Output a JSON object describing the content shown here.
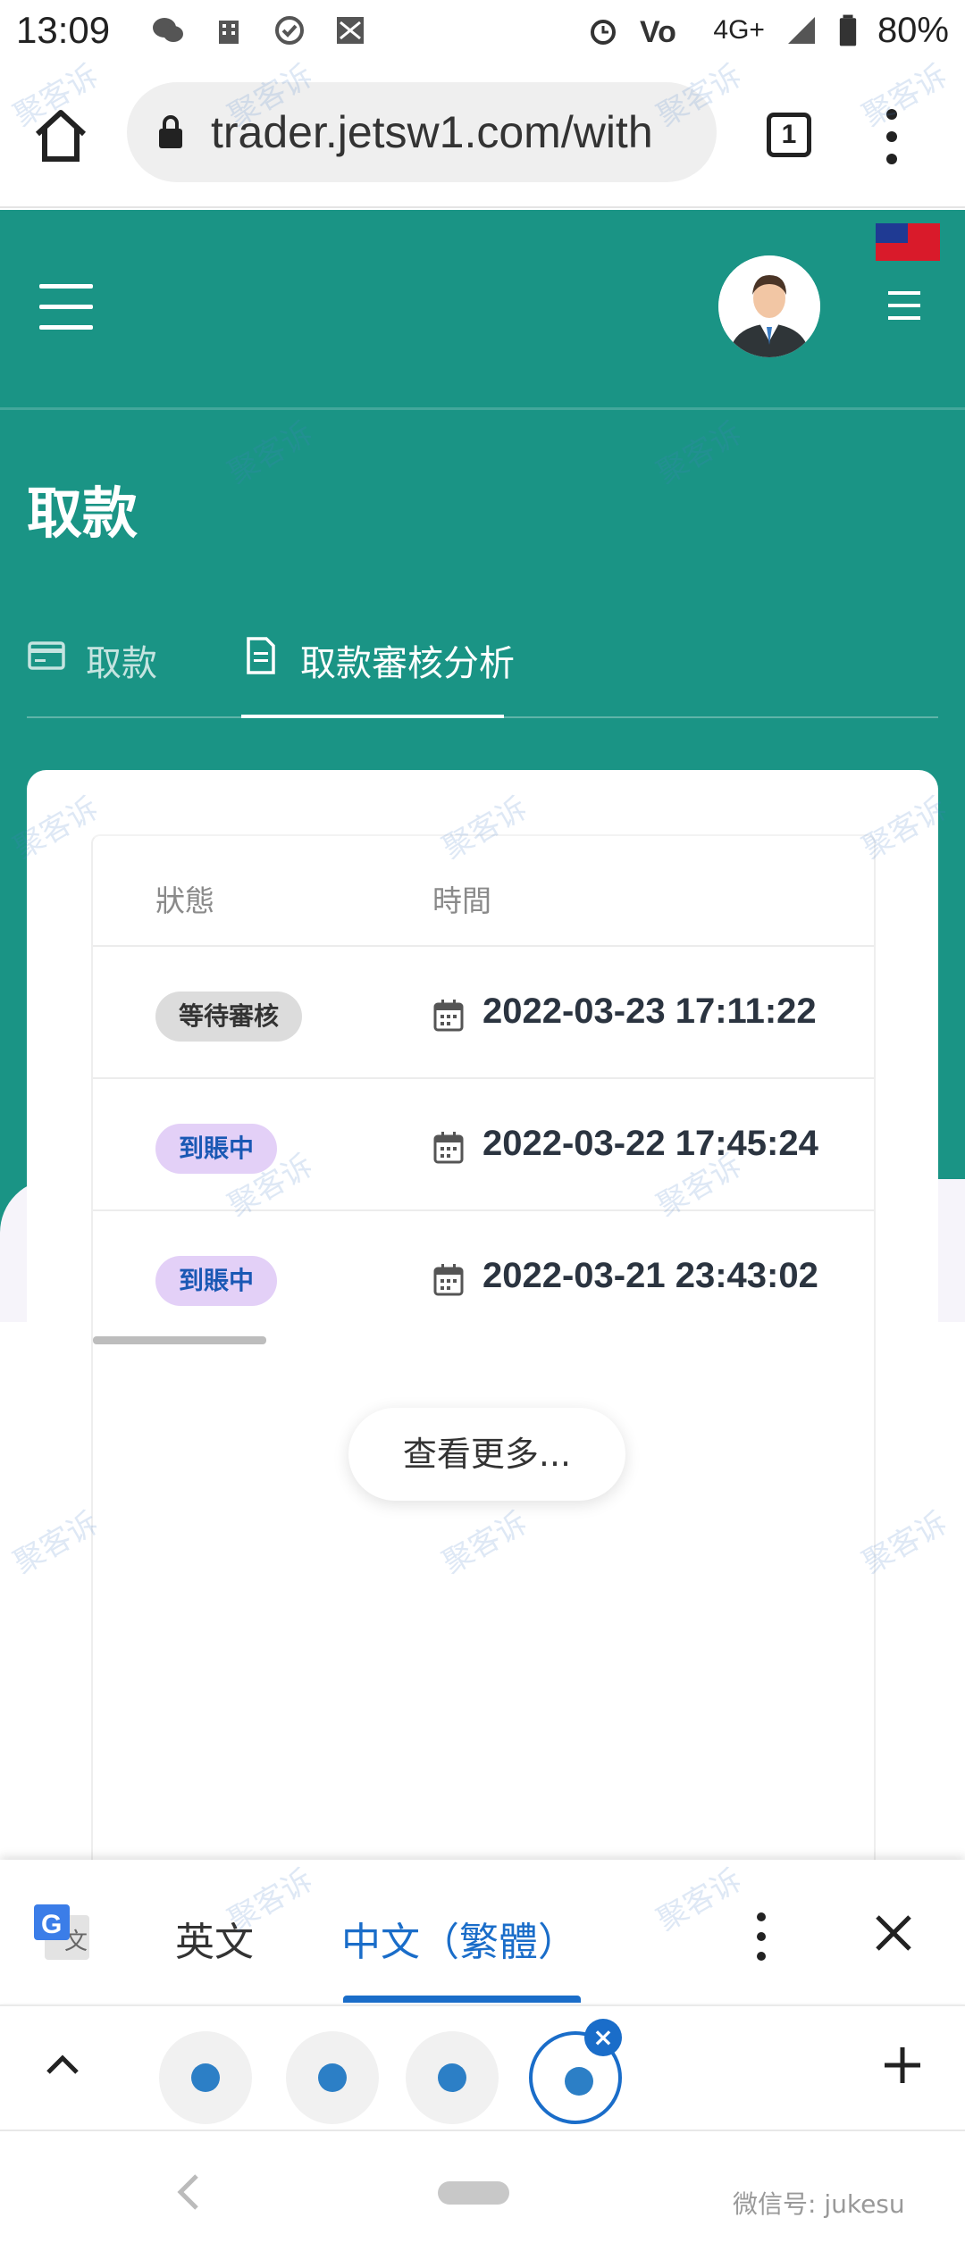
{
  "status_bar": {
    "time": "13:09",
    "network": "4G+",
    "battery": "80%"
  },
  "browser": {
    "url": "trader.jetsw1.com/with",
    "tab_count": "1"
  },
  "page": {
    "title": "取款",
    "tabs": [
      {
        "label": "取款",
        "icon": "card-icon"
      },
      {
        "label": "取款審核分析",
        "icon": "document-icon"
      }
    ],
    "table": {
      "headers": {
        "status": "狀態",
        "time": "時間"
      },
      "rows": [
        {
          "status": "等待審核",
          "status_type": "pending",
          "datetime": "2022-03-23 17:11:22"
        },
        {
          "status": "到賬中",
          "status_type": "arriving",
          "datetime": "2022-03-22 17:45:24"
        },
        {
          "status": "到賬中",
          "status_type": "arriving",
          "datetime": "2022-03-21 23:43:02"
        }
      ]
    },
    "load_more_label": "查看更多..."
  },
  "translate_bar": {
    "source_lang": "英文",
    "target_lang": "中文（繁體）"
  },
  "watermark": {
    "text": "聚客诉",
    "corner_text": "微信号: jukesu"
  },
  "colors": {
    "header_teal": "#1a9485",
    "accent_blue": "#1a6dc9",
    "pending_badge_bg": "#dcdcdc",
    "arriving_badge_bg": "#e3d0f7"
  }
}
